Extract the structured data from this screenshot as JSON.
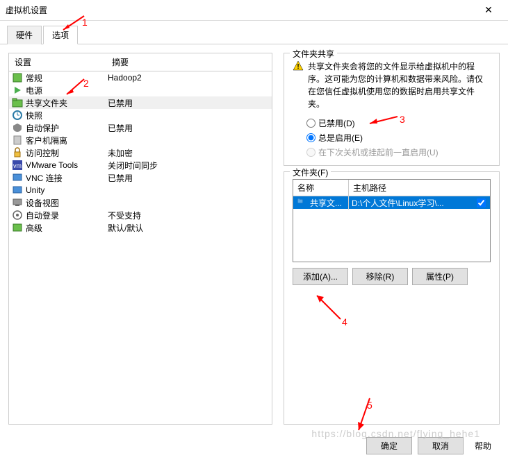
{
  "window": {
    "title": "虚拟机设置"
  },
  "tabs": {
    "hardware": "硬件",
    "options": "选项"
  },
  "leftHeader": {
    "setting": "设置",
    "summary": "摘要"
  },
  "rows": [
    {
      "label": "常规",
      "summary": "Hadoop2"
    },
    {
      "label": "电源",
      "summary": ""
    },
    {
      "label": "共享文件夹",
      "summary": "已禁用"
    },
    {
      "label": "快照",
      "summary": ""
    },
    {
      "label": "自动保护",
      "summary": "已禁用"
    },
    {
      "label": "客户机隔离",
      "summary": ""
    },
    {
      "label": "访问控制",
      "summary": "未加密"
    },
    {
      "label": "VMware Tools",
      "summary": "关闭时间同步"
    },
    {
      "label": "VNC 连接",
      "summary": "已禁用"
    },
    {
      "label": "Unity",
      "summary": ""
    },
    {
      "label": "设备视图",
      "summary": ""
    },
    {
      "label": "自动登录",
      "summary": "不受支持"
    },
    {
      "label": "高级",
      "summary": "默认/默认"
    }
  ],
  "share": {
    "groupTitle": "文件夹共享",
    "warning": "共享文件夹会将您的文件显示给虚拟机中的程序。这可能为您的计算机和数据带来风险。请仅在您信任虚拟机使用您的数据时启用共享文件夹。",
    "radios": {
      "disabled": "已禁用(D)",
      "always": "总是启用(E)",
      "untilOff": "在下次关机或挂起前一直启用(U)"
    }
  },
  "folders": {
    "groupTitle": "文件夹(F)",
    "header": {
      "name": "名称",
      "path": "主机路径"
    },
    "row": {
      "name": "共享文...",
      "path": "D:\\个人文件\\Linux学习\\..."
    },
    "buttons": {
      "add": "添加(A)...",
      "remove": "移除(R)",
      "props": "属性(P)"
    }
  },
  "dialog": {
    "ok": "确定",
    "cancel": "取消",
    "help": "帮助"
  },
  "annotations": {
    "a1": "1",
    "a2": "2",
    "a3": "3",
    "a4": "4",
    "a5": "5"
  }
}
